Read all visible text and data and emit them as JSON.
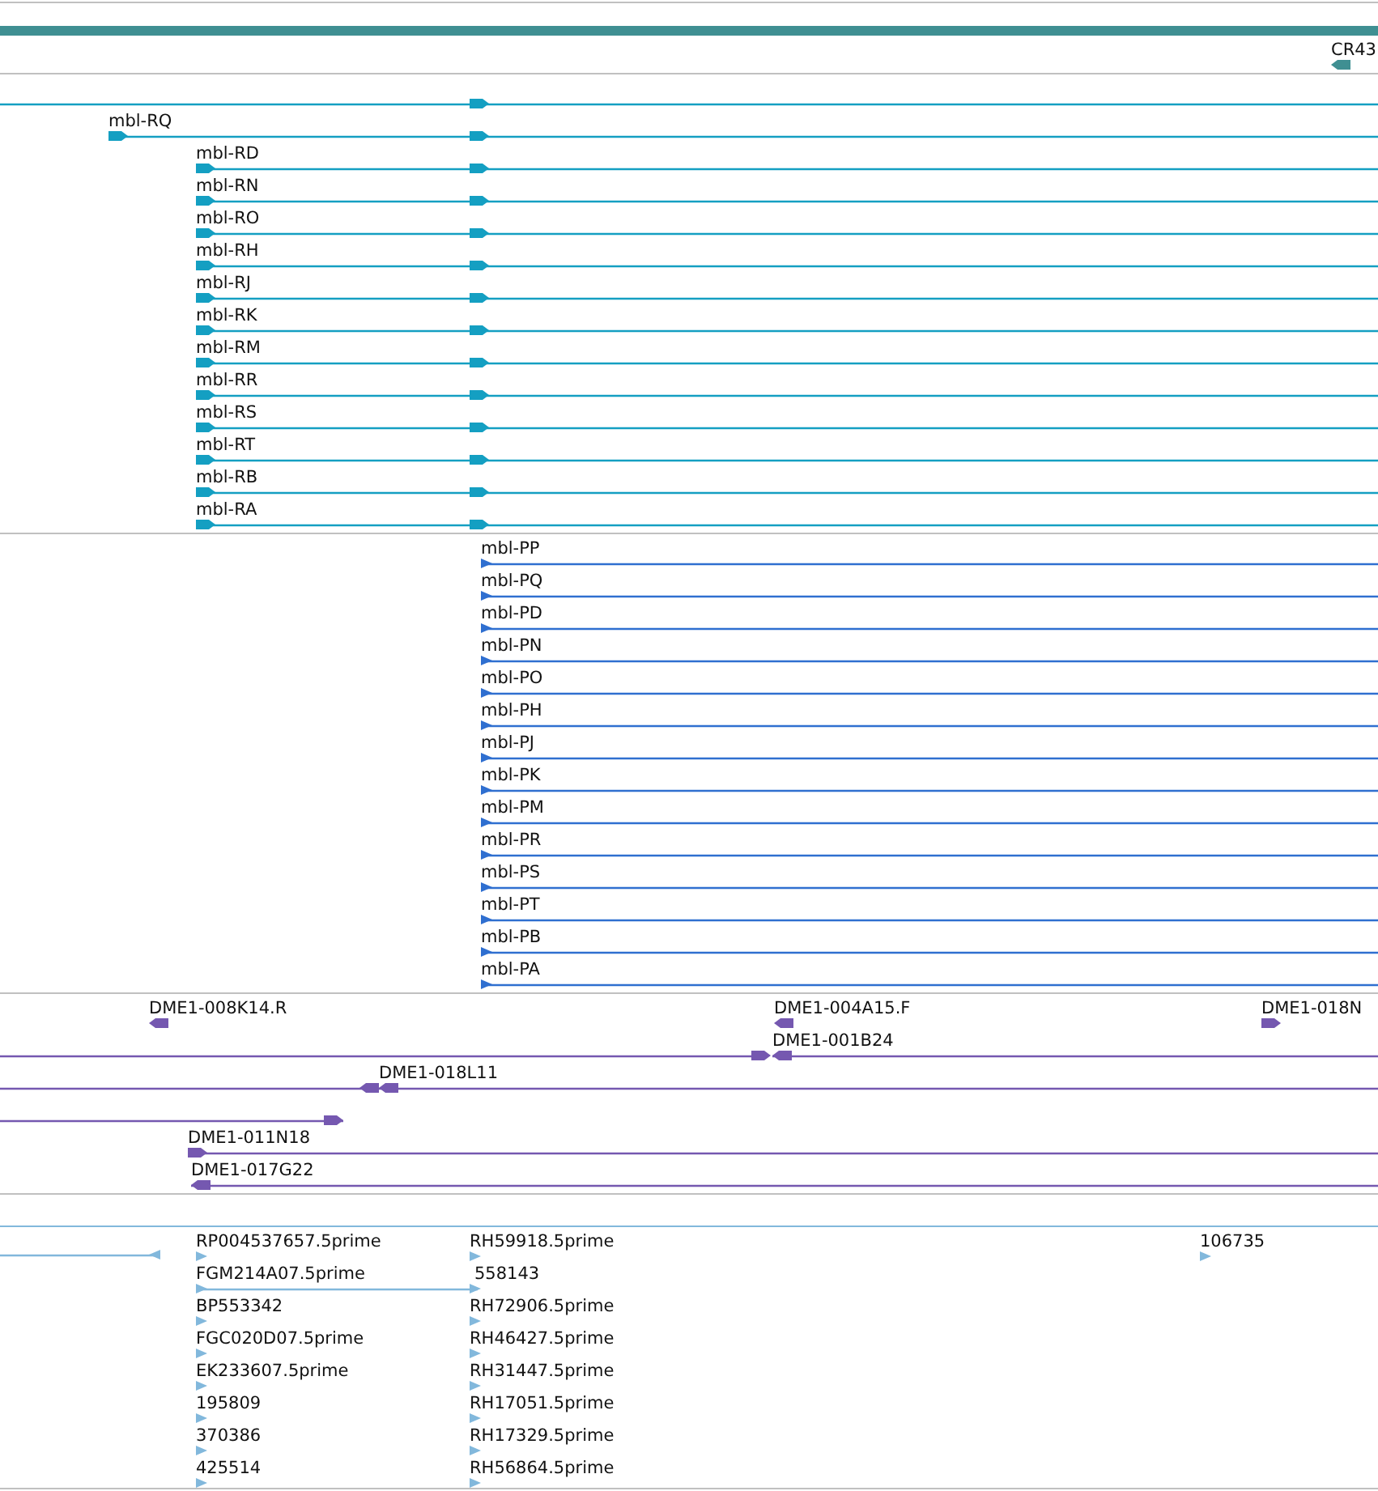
{
  "tracks": [
    {
      "kind": "gene",
      "features": [
        {
          "label": "CR43",
          "reverse": true
        }
      ]
    },
    {
      "kind": "transcript",
      "features": [
        {
          "reverse": false
        },
        {
          "label": "mbl-RQ",
          "reverse": false
        },
        {
          "label": "mbl-RD",
          "reverse": false
        },
        {
          "label": "mbl-RN",
          "reverse": false
        },
        {
          "label": "mbl-RO",
          "reverse": false
        },
        {
          "label": "mbl-RH",
          "reverse": false
        },
        {
          "label": "mbl-RJ",
          "reverse": false
        },
        {
          "label": "mbl-RK",
          "reverse": false
        },
        {
          "label": "mbl-RM",
          "reverse": false
        },
        {
          "label": "mbl-RR",
          "reverse": false
        },
        {
          "label": "mbl-RS",
          "reverse": false
        },
        {
          "label": "mbl-RT",
          "reverse": false
        },
        {
          "label": "mbl-RB",
          "reverse": false
        },
        {
          "label": "mbl-RA",
          "reverse": false
        }
      ]
    },
    {
      "kind": "protein",
      "features": [
        {
          "label": "mbl-PP",
          "reverse": false
        },
        {
          "label": "mbl-PQ",
          "reverse": false
        },
        {
          "label": "mbl-PD",
          "reverse": false
        },
        {
          "label": "mbl-PN",
          "reverse": false
        },
        {
          "label": "mbl-PO",
          "reverse": false
        },
        {
          "label": "mbl-PH",
          "reverse": false
        },
        {
          "label": "mbl-PJ",
          "reverse": false
        },
        {
          "label": "mbl-PK",
          "reverse": false
        },
        {
          "label": "mbl-PM",
          "reverse": false
        },
        {
          "label": "mbl-PR",
          "reverse": false
        },
        {
          "label": "mbl-PS",
          "reverse": false
        },
        {
          "label": "mbl-PT",
          "reverse": false
        },
        {
          "label": "mbl-PB",
          "reverse": false
        },
        {
          "label": "mbl-PA",
          "reverse": false
        }
      ]
    },
    {
      "kind": "clone",
      "features": [
        {
          "label": "DME1-008K14.R",
          "reverse": true
        },
        {
          "label": "DME1-004A15.F",
          "reverse": true
        },
        {
          "label": "DME1-018N",
          "reverse": false
        },
        {
          "reverse": false
        },
        {
          "label": "DME1-001B24",
          "reverse": true
        },
        {
          "reverse": true
        },
        {
          "label": "DME1-018L11",
          "reverse": true
        },
        {
          "reverse": false
        },
        {
          "label": "DME1-011N18",
          "reverse": false
        },
        {
          "label": "DME1-017G22",
          "reverse": true
        }
      ]
    },
    {
      "kind": "est",
      "features": [
        {
          "reverse": true
        },
        {
          "label": "RP004537657.5prime",
          "reverse": false
        },
        {
          "label": "FGM214A07.5prime",
          "reverse": false
        },
        {
          "label": "BP553342",
          "reverse": false
        },
        {
          "label": "FGC020D07.5prime",
          "reverse": false
        },
        {
          "label": "EK233607.5prime",
          "reverse": false
        },
        {
          "label": "195809",
          "reverse": false
        },
        {
          "label": "370386",
          "reverse": false
        },
        {
          "label": "425514",
          "reverse": false
        },
        {
          "label": "RH59918.5prime",
          "reverse": false
        },
        {
          "label": "558143",
          "reverse": false
        },
        {
          "label": "RH72906.5prime",
          "reverse": false
        },
        {
          "label": "RH46427.5prime",
          "reverse": false
        },
        {
          "label": "RH31447.5prime",
          "reverse": false
        },
        {
          "label": "RH17051.5prime",
          "reverse": false
        },
        {
          "label": "RH17329.5prime",
          "reverse": false
        },
        {
          "label": "RH56864.5prime",
          "reverse": false
        },
        {
          "label": "106735",
          "reverse": false
        }
      ]
    }
  ]
}
